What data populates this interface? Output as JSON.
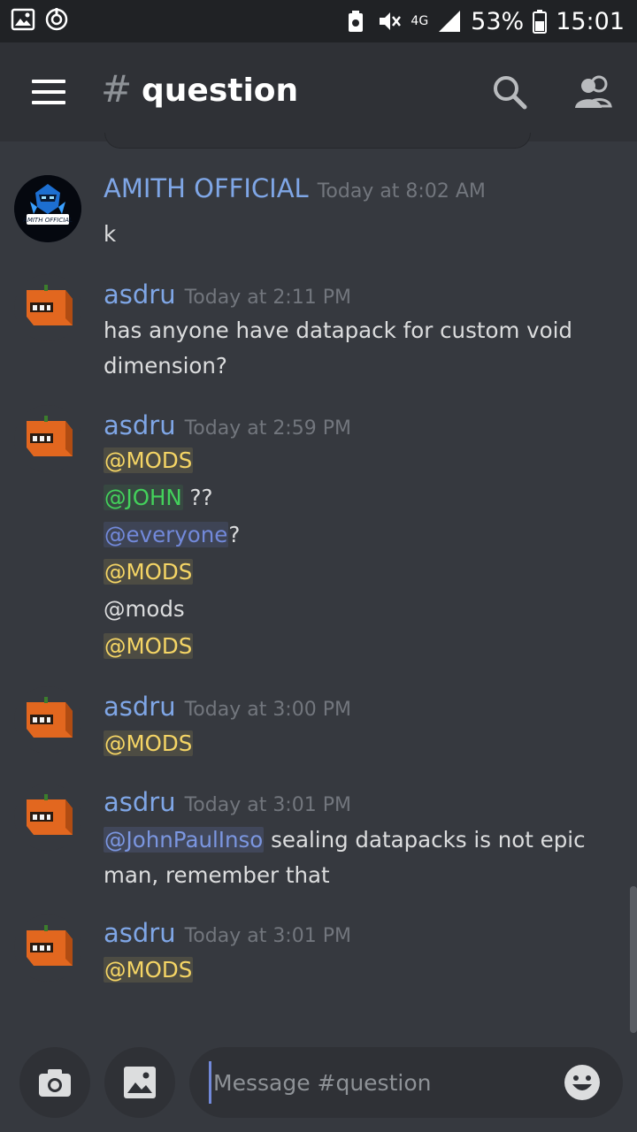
{
  "status_bar": {
    "network": "4G",
    "battery": "53%",
    "time": "15:01"
  },
  "header": {
    "hash": "#",
    "channel": "question"
  },
  "messages": [
    {
      "username": "AMITH OFFICIAL",
      "timestamp": "Today at 8:02 AM",
      "avatar_text": "AMITH OFFICIAL",
      "lines": [
        "k"
      ]
    },
    {
      "username": "asdru",
      "timestamp": "Today at 2:11 PM",
      "lines": [
        "has anyone have datapack for custom void",
        "dimension?"
      ]
    },
    {
      "username": "asdru",
      "timestamp": "Today at 2:59 PM",
      "lines": [
        {
          "mention": "@MODS"
        },
        {
          "mention": "@JOHN",
          "after": " ??"
        },
        {
          "mention": "@everyone",
          "after": "?"
        },
        {
          "mention": "@MODS"
        },
        {
          "text": "@mods"
        },
        {
          "mention": "@MODS"
        }
      ]
    },
    {
      "username": "asdru",
      "timestamp": "Today at 3:00 PM",
      "lines": [
        {
          "mention": "@MODS"
        }
      ]
    },
    {
      "username": "asdru",
      "timestamp": "Today at 3:01 PM",
      "lines": [
        {
          "mention": "@JohnPaulInso",
          "after": " sealing datapacks is not epic"
        },
        "man, remember that"
      ]
    },
    {
      "username": "asdru",
      "timestamp": "Today at 3:01 PM",
      "lines": [
        {
          "mention": "@MODS"
        }
      ]
    }
  ],
  "composer": {
    "placeholder": "Message #question"
  },
  "colors": {
    "background": "#36393f",
    "header": "#2f3136",
    "username": "#7fa6e6",
    "mods_mention": "#f5d565",
    "john_mention": "#43d15b",
    "everyone_mention": "#7289da"
  }
}
